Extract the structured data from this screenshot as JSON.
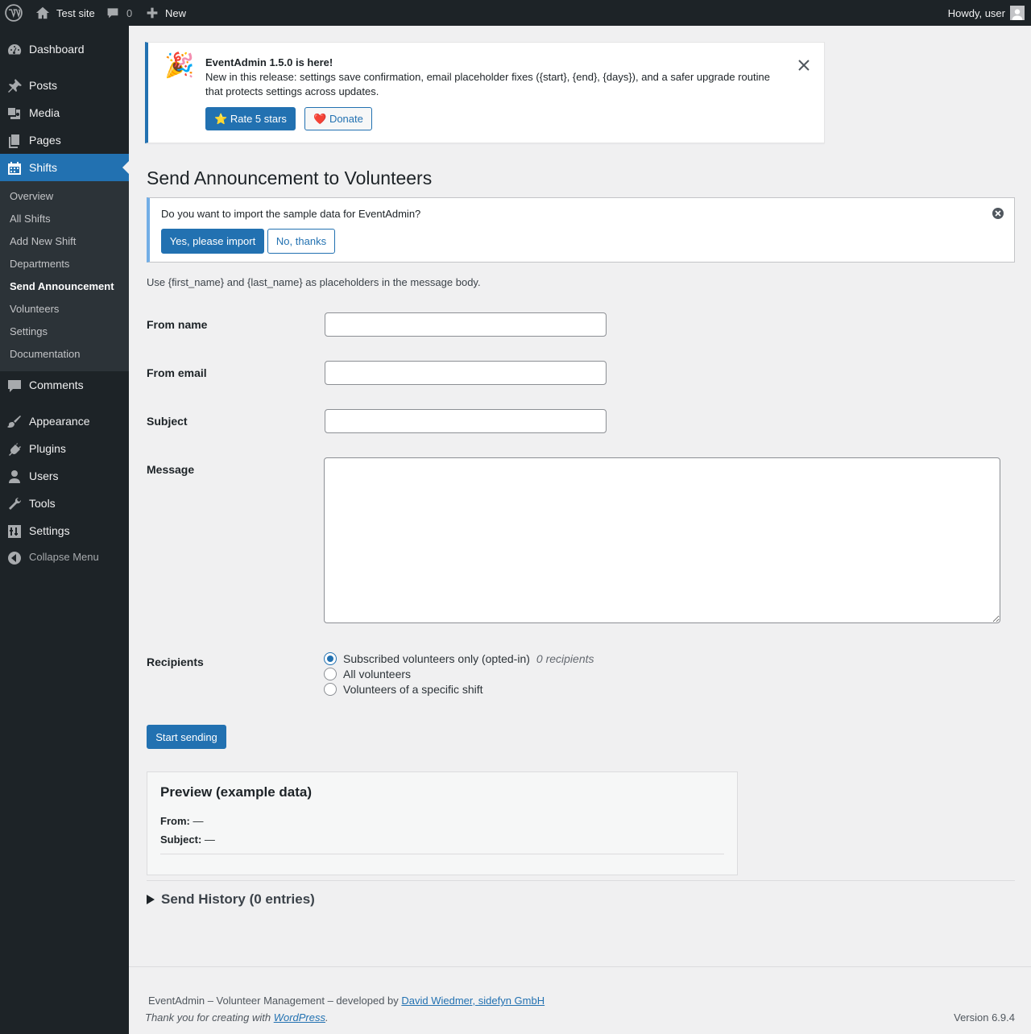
{
  "admin_bar": {
    "site_name": "Test site",
    "comments_count": "0",
    "new_label": "New",
    "howdy": "Howdy, user"
  },
  "sidebar": {
    "items": [
      {
        "label": "Dashboard",
        "icon": "dashboard-icon"
      },
      {
        "label": "Posts",
        "icon": "pin-icon"
      },
      {
        "label": "Media",
        "icon": "media-icon"
      },
      {
        "label": "Pages",
        "icon": "pages-icon"
      },
      {
        "label": "Shifts",
        "icon": "calendar-icon"
      },
      {
        "label": "Comments",
        "icon": "comment-icon"
      },
      {
        "label": "Appearance",
        "icon": "paintbrush-icon"
      },
      {
        "label": "Plugins",
        "icon": "plugin-icon"
      },
      {
        "label": "Users",
        "icon": "user-icon"
      },
      {
        "label": "Tools",
        "icon": "wrench-icon"
      },
      {
        "label": "Settings",
        "icon": "settings-icon"
      }
    ],
    "submenu": [
      "Overview",
      "All Shifts",
      "Add New Shift",
      "Departments",
      "Send Announcement",
      "Volunteers",
      "Settings",
      "Documentation"
    ],
    "collapse_label": "Collapse Menu"
  },
  "release_notice": {
    "emoji": "🎉",
    "title": "EventAdmin 1.5.0 is here!",
    "body": "New in this release: settings save confirmation, email placeholder fixes ({start}, {end}, {days}), and a safer upgrade routine that protects settings across updates.",
    "rate_label": "⭐ Rate 5 stars",
    "donate_label": "❤️ Donate"
  },
  "page_title": "Send Announcement to Volunteers",
  "import_notice": {
    "text": "Do you want to import the sample data for EventAdmin?",
    "yes_label": "Yes, please import",
    "no_label": "No, thanks"
  },
  "placeholder_hint": "Use {first_name} and {last_name} as placeholders in the message body.",
  "form": {
    "from_name_label": "From name",
    "from_name_value": "",
    "from_email_label": "From email",
    "from_email_value": "",
    "subject_label": "Subject",
    "subject_value": "",
    "message_label": "Message",
    "message_value": "",
    "recipients_label": "Recipients",
    "recipients_options": [
      "Subscribed volunteers only (opted-in)",
      "All volunteers",
      "Volunteers of a specific shift"
    ],
    "recipients_selected": "Subscribed volunteers only (opted-in)",
    "recipients_count": "0 recipients",
    "submit_label": "Start sending"
  },
  "preview": {
    "title": "Preview (example data)",
    "from_label": "From:",
    "from_value": "—",
    "subject_label": "Subject:",
    "subject_value": "—"
  },
  "history_label": "Send History (0 entries)",
  "footer": {
    "credit_prefix": "EventAdmin – Volunteer Management – developed by",
    "credit_link": "David Wiedmer, sidefyn GmbH",
    "thanks_prefix": "Thank you for creating with",
    "thanks_link": "WordPress",
    "thanks_suffix": ".",
    "version": "Version 6.9.4"
  },
  "colors": {
    "accent": "#2271b1",
    "admin_bg": "#1d2327",
    "submenu_bg": "#2c3338",
    "page_bg": "#f0f0f1"
  }
}
